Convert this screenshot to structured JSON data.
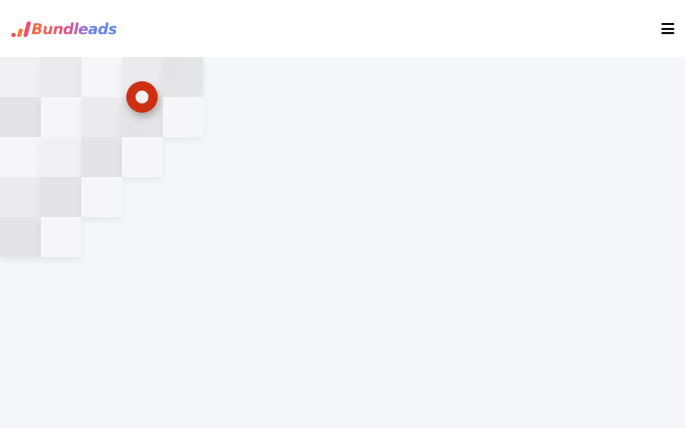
{
  "header": {
    "logo_text": "Bundleads",
    "menu_icon": "hamburger-menu-icon"
  },
  "loader": {
    "icon": "loading-ring-icon",
    "color": "#cc2f12"
  },
  "colors": {
    "background": "#f4f6fa",
    "header": "#ffffff",
    "logo_gradient_start": "#f56a3c",
    "logo_gradient_end": "#5b86f2"
  }
}
